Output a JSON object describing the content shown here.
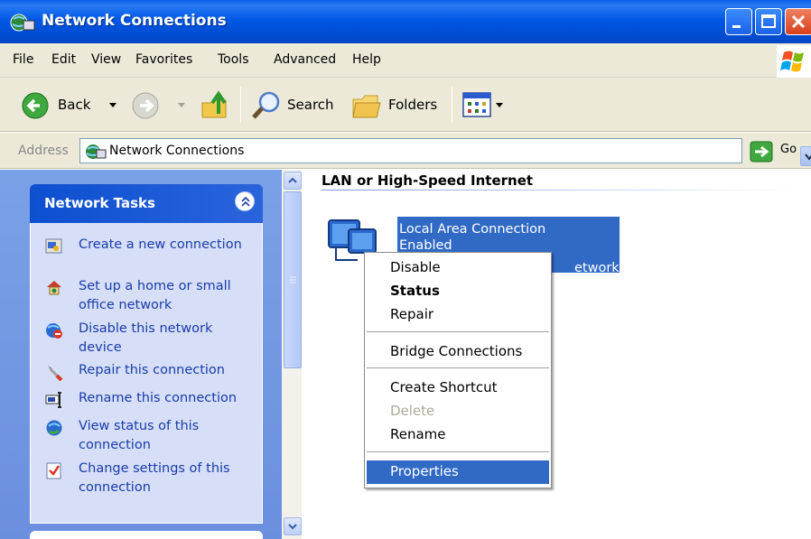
{
  "window": {
    "title": "Network Connections"
  },
  "menu": [
    "File",
    "Edit",
    "View",
    "Favorites",
    "Tools",
    "Advanced",
    "Help"
  ],
  "toolbar": {
    "back_label": "Back",
    "search_label": "Search",
    "folders_label": "Folders"
  },
  "address": {
    "label": "Address",
    "value": "Network Connections",
    "go_label": "Go"
  },
  "tasks": {
    "title": "Network Tasks",
    "items": [
      {
        "label": "Create a new connection",
        "icon": "new-connection-icon"
      },
      {
        "label": "Set up a home or small office network",
        "icon": "home-network-icon"
      },
      {
        "label": "Disable this network device",
        "icon": "disable-device-icon"
      },
      {
        "label": "Repair this connection",
        "icon": "repair-icon"
      },
      {
        "label": "Rename this connection",
        "icon": "rename-icon"
      },
      {
        "label": "View status of this connection",
        "icon": "status-icon"
      },
      {
        "label": "Change settings of this connection",
        "icon": "settings-icon"
      }
    ]
  },
  "main": {
    "group_title": "LAN or High-Speed Internet",
    "connection": {
      "name": "Local Area Connection",
      "status": "Enabled",
      "device_tail": "etwork ..."
    }
  },
  "context_menu": {
    "items": [
      "Disable",
      "Status",
      "Repair",
      "Bridge Connections",
      "Create Shortcut",
      "Delete",
      "Rename",
      "Properties"
    ],
    "selected": "Properties",
    "disabled": [
      "Delete"
    ],
    "default": "Status"
  },
  "colors": {
    "titlebar": "#0058e6",
    "selection": "#316ac5",
    "taskpane": "#7aa1e6"
  }
}
